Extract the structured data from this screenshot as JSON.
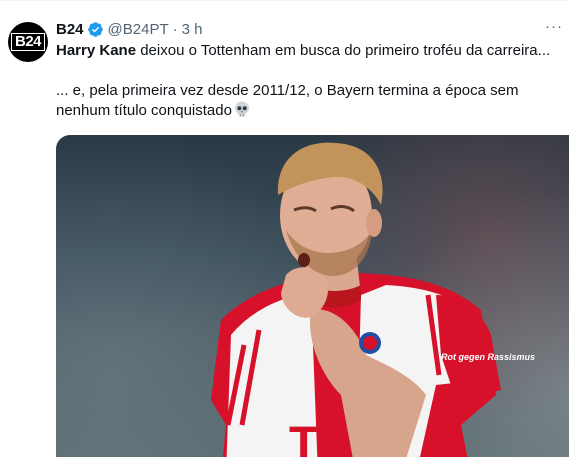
{
  "author": {
    "avatar_text": "B24",
    "name": "B24",
    "handle": "@B24PT",
    "separator": "·",
    "time": "3 h"
  },
  "tweet": {
    "line1_bold": "Harry Kane",
    "line1_rest": " deixou o Tottenham em busca do primeiro troféu da carreira...",
    "line2": "... e, pela primeira vez desde 2011/12, o Bayern termina a época sem nenhum título conquistado"
  },
  "media": {
    "jersey_text": "T",
    "sleeve_text": "Rot gegen Rassismus"
  },
  "colors": {
    "verified": "#1d9bf0",
    "jersey_red": "#d8112a",
    "jersey_white": "#f4f4f4"
  },
  "icons": {
    "verified": "verified-badge-icon",
    "skull": "skull-emoji-icon",
    "more": "more-options-icon"
  }
}
